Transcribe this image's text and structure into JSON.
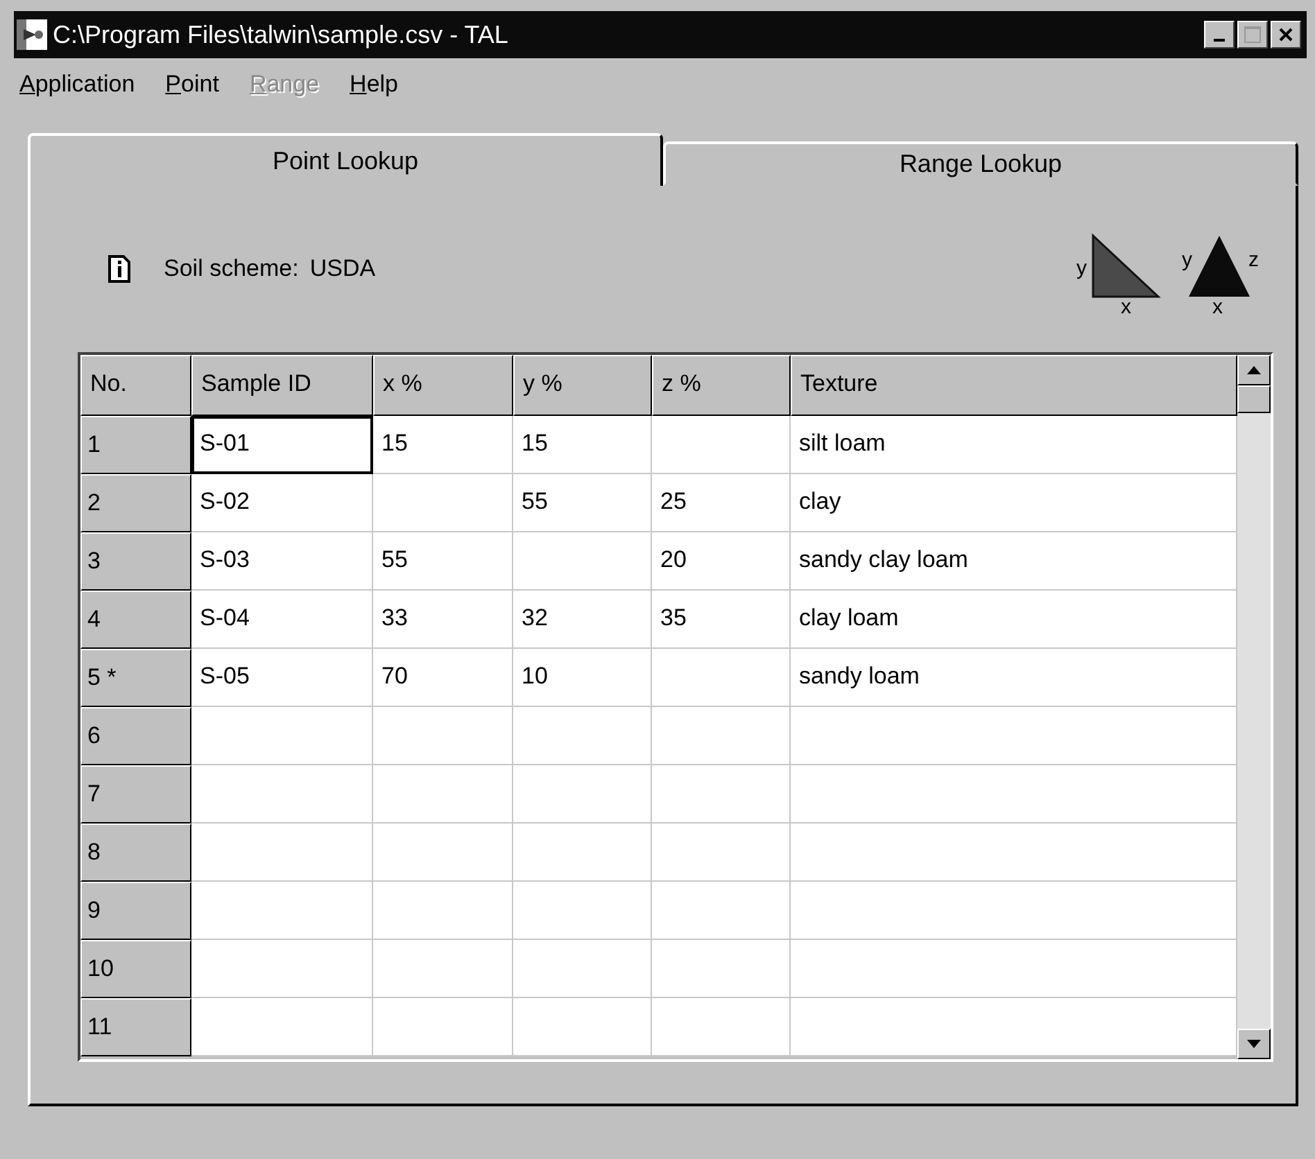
{
  "window": {
    "title": "C:\\Program Files\\talwin\\sample.csv - TAL"
  },
  "menu": [
    {
      "label": "Application",
      "disabled": false
    },
    {
      "label": "Point",
      "disabled": false
    },
    {
      "label": "Range",
      "disabled": true
    },
    {
      "label": "Help",
      "disabled": false
    }
  ],
  "tabs": [
    {
      "label": "Point Lookup",
      "selected": true
    },
    {
      "label": "Range Lookup",
      "selected": false
    }
  ],
  "scheme": {
    "label": "Soil scheme:",
    "value": "USDA"
  },
  "diagrams": [
    {
      "kind": "right",
      "labels": [
        "y",
        "x"
      ]
    },
    {
      "kind": "equilateral",
      "labels": [
        "y",
        "z",
        "x"
      ]
    }
  ],
  "table": {
    "columns": [
      "No.",
      "Sample ID",
      "x %",
      "y %",
      "z %",
      "Texture"
    ],
    "rows": [
      {
        "cells": [
          {
            "text": "1",
            "focused": false
          },
          {
            "text": "S-01",
            "focused": true
          },
          {
            "text": "15",
            "focused": false
          },
          {
            "text": "15",
            "focused": false
          },
          {
            "focused": false
          },
          {
            "text": "silt loam",
            "focused": false
          }
        ]
      },
      {
        "cells": [
          {
            "text": "2",
            "focused": false
          },
          {
            "text": "S-02",
            "focused": false
          },
          {
            "focused": false
          },
          {
            "text": "55",
            "focused": false
          },
          {
            "text": "25",
            "focused": false
          },
          {
            "text": "clay",
            "focused": false
          }
        ]
      },
      {
        "cells": [
          {
            "text": "3",
            "focused": false
          },
          {
            "text": "S-03",
            "focused": false
          },
          {
            "text": "55",
            "focused": false
          },
          {
            "focused": false
          },
          {
            "text": "20",
            "focused": false
          },
          {
            "text": "sandy clay loam",
            "focused": false
          }
        ]
      },
      {
        "cells": [
          {
            "text": "4",
            "focused": false
          },
          {
            "text": "S-04",
            "focused": false
          },
          {
            "text": "33",
            "focused": false
          },
          {
            "text": "32",
            "focused": false
          },
          {
            "text": "35",
            "focused": false
          },
          {
            "text": "clay loam",
            "focused": false
          }
        ]
      },
      {
        "cells": [
          {
            "text": "5 *",
            "focused": false
          },
          {
            "text": "S-05",
            "focused": false
          },
          {
            "text": "70",
            "focused": false
          },
          {
            "text": "10",
            "focused": false
          },
          {
            "focused": false
          },
          {
            "text": "sandy loam",
            "focused": false
          }
        ]
      },
      {
        "cells": [
          {
            "text": "6",
            "focused": false
          },
          {
            "focused": false
          },
          {
            "focused": false
          },
          {
            "focused": false
          },
          {
            "focused": false
          },
          {
            "focused": false
          }
        ]
      },
      {
        "cells": [
          {
            "text": "7",
            "focused": false
          },
          {
            "focused": false
          },
          {
            "focused": false
          },
          {
            "focused": false
          },
          {
            "focused": false
          },
          {
            "focused": false
          }
        ]
      },
      {
        "cells": [
          {
            "text": "8",
            "focused": false
          },
          {
            "focused": false
          },
          {
            "focused": false
          },
          {
            "focused": false
          },
          {
            "focused": false
          },
          {
            "focused": false
          }
        ]
      },
      {
        "cells": [
          {
            "text": "9",
            "focused": false
          },
          {
            "focused": false
          },
          {
            "focused": false
          },
          {
            "focused": false
          },
          {
            "focused": false
          },
          {
            "focused": false
          }
        ]
      },
      {
        "cells": [
          {
            "text": "10",
            "focused": false
          },
          {
            "focused": false
          },
          {
            "focused": false
          },
          {
            "focused": false
          },
          {
            "focused": false
          },
          {
            "focused": false
          }
        ]
      },
      {
        "cells": [
          {
            "text": "11",
            "focused": false
          },
          {
            "focused": false
          },
          {
            "focused": false
          },
          {
            "focused": false
          },
          {
            "focused": false
          },
          {
            "focused": false
          }
        ]
      }
    ]
  }
}
